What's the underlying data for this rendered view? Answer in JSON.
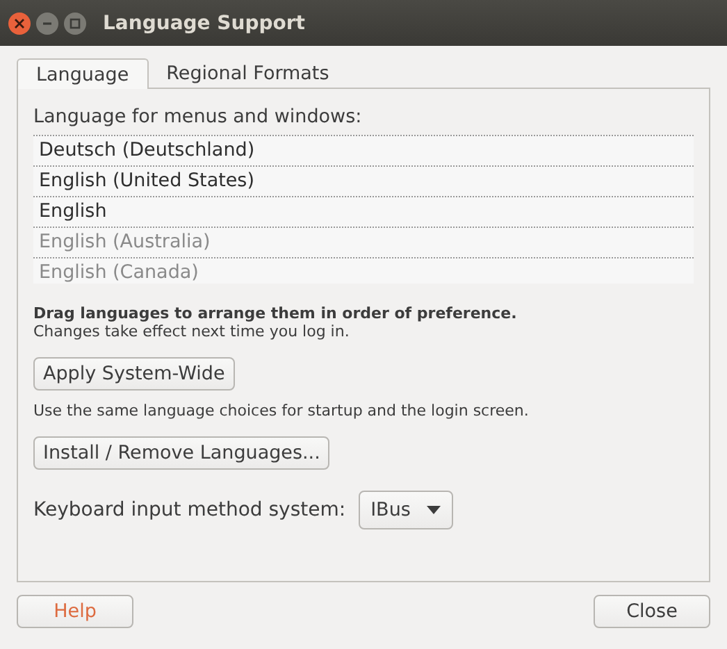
{
  "window": {
    "title": "Language Support"
  },
  "tabs": [
    {
      "label": "Language",
      "selected": true
    },
    {
      "label": "Regional Formats",
      "selected": false
    }
  ],
  "language_list": {
    "label": "Language for menus and windows:",
    "items": [
      {
        "name": "Deutsch (Deutschland)",
        "disabled": false
      },
      {
        "name": "English (United States)",
        "disabled": false
      },
      {
        "name": "English",
        "disabled": false
      },
      {
        "name": "English (Australia)",
        "disabled": true
      },
      {
        "name": "English (Canada)",
        "disabled": true
      }
    ]
  },
  "hint": {
    "bold": "Drag languages to arrange them in order of preference.",
    "note": "Changes take effect next time you log in."
  },
  "apply_button": "Apply System-Wide",
  "apply_note": "Use the same language choices for startup and the login screen.",
  "install_button": "Install / Remove Languages...",
  "keyboard_input": {
    "label": "Keyboard input method system:",
    "value": "IBus"
  },
  "buttons": {
    "help": "Help",
    "close": "Close"
  }
}
